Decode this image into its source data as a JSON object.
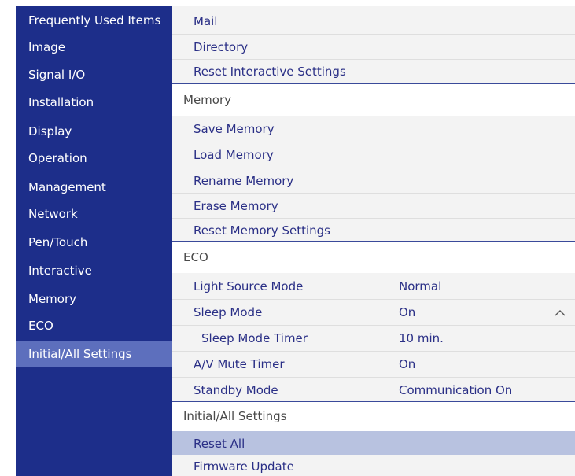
{
  "sidebar": {
    "items": [
      {
        "label": "Frequently Used Items"
      },
      {
        "label": "Image"
      },
      {
        "label": "Signal I/O"
      },
      {
        "label": "Installation"
      },
      {
        "label": "Display"
      },
      {
        "label": "Operation"
      },
      {
        "label": "Management"
      },
      {
        "label": "Network"
      },
      {
        "label": "Pen/Touch"
      },
      {
        "label": "Interactive"
      },
      {
        "label": "Memory"
      },
      {
        "label": "ECO"
      },
      {
        "label": "Initial/All Settings"
      }
    ],
    "selected": "Initial/All Settings"
  },
  "content": {
    "top_items": [
      {
        "label": "Mail"
      },
      {
        "label": "Directory"
      },
      {
        "label": "Reset Interactive Settings"
      }
    ],
    "memory_section": {
      "title": "Memory",
      "items": [
        {
          "label": "Save Memory"
        },
        {
          "label": "Load Memory"
        },
        {
          "label": "Rename Memory"
        },
        {
          "label": "Erase Memory"
        },
        {
          "label": "Reset Memory Settings"
        }
      ]
    },
    "eco_section": {
      "title": "ECO",
      "items": [
        {
          "label": "Light Source Mode",
          "value": "Normal"
        },
        {
          "label": "Sleep Mode",
          "value": "On"
        },
        {
          "label": "Sleep Mode Timer",
          "value": "10 min."
        },
        {
          "label": "A/V Mute Timer",
          "value": "On"
        },
        {
          "label": "Standby Mode",
          "value": "Communication On"
        }
      ]
    },
    "initial_section": {
      "title": "Initial/All Settings",
      "items": [
        {
          "label": "Reset All"
        },
        {
          "label": "Firmware Update"
        }
      ],
      "highlighted": "Reset All"
    }
  },
  "icons": {
    "expand_collapse": "chevron-up-icon"
  },
  "colors": {
    "sidebar_bg": "#1d2e8a",
    "sidebar_selected": "#5d6fbd",
    "content_bg": "#f3f3f3",
    "item_text": "#2a2f86",
    "highlight_row": "#b8c2e0"
  }
}
